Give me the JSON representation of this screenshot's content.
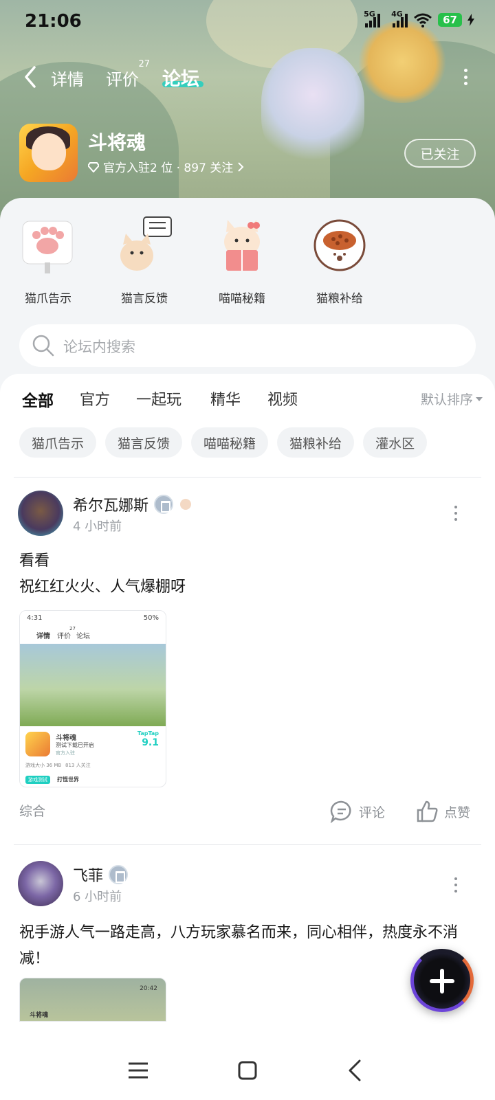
{
  "status_bar": {
    "time": "21:06",
    "net1": "5G",
    "net2": "4G",
    "battery": "67"
  },
  "nav": {
    "tabs": [
      {
        "label": "详情"
      },
      {
        "label": "评价",
        "count": "27"
      },
      {
        "label": "论坛"
      }
    ],
    "active_tab": "论坛"
  },
  "game": {
    "name": "斗将魂",
    "meta": "官方入驻2 位 · 897 关注",
    "follow_label": "已关注"
  },
  "categories": [
    {
      "label": "猫爪告示",
      "icon": "cat-paw-icon"
    },
    {
      "label": "猫言反馈",
      "icon": "cat-feedback-icon"
    },
    {
      "label": "喵喵秘籍",
      "icon": "cat-book-icon"
    },
    {
      "label": "猫粮补给",
      "icon": "cat-food-bowl-icon"
    }
  ],
  "search": {
    "placeholder": "论坛内搜索"
  },
  "feed_tabs": [
    "全部",
    "官方",
    "一起玩",
    "精华",
    "视频"
  ],
  "active_feed_tab": "全部",
  "sort_label": "默认排序",
  "chips": [
    "猫爪告示",
    "猫言反馈",
    "喵喵秘籍",
    "猫粮补给",
    "灌水区"
  ],
  "posts": [
    {
      "author": "希尔瓦娜斯",
      "time": "4 小时前",
      "lines": [
        "看看",
        "祝红红火火、人气爆棚呀"
      ],
      "shot": {
        "time": "4:31",
        "battery": "50%",
        "tabs": [
          "详情",
          "评价",
          "论坛"
        ],
        "tab_count": "27",
        "game": "斗将魂",
        "sub": "测试下载已开启",
        "official": "官方入驻",
        "score_brand": "TapTap",
        "score": "9.1",
        "size": "游戏大小 36 MB",
        "fans": "813 人关注",
        "pill": "游戏测试",
        "pill_text": "打怪世界"
      },
      "tag": "综合",
      "comment_label": "评论",
      "like_label": "点赞"
    },
    {
      "author": "飞菲",
      "time": "6 小时前",
      "lines": [
        "祝手游人气一路走高，八方玩家慕名而来，同心相伴，热度永不消减！"
      ],
      "shot_game": "斗将魂",
      "shot_time": "20:42"
    }
  ],
  "colors": {
    "accent": "#1fcfc1",
    "battery": "#27c04a",
    "fab_ring": "#6c44d9"
  }
}
